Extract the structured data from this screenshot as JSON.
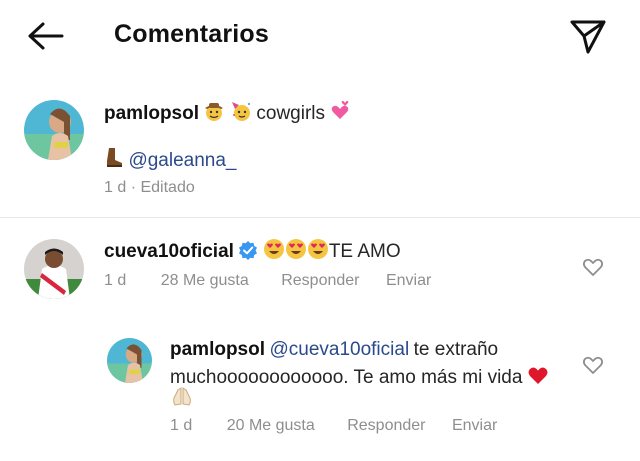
{
  "header": {
    "title": "Comentarios",
    "back_icon": "arrow-left-icon",
    "share_icon": "paper-plane-icon"
  },
  "caption": {
    "username": "pamlopsol",
    "text": "cowgirls",
    "line2_mention": "@galeanna_",
    "time": "1 d",
    "separator": "·",
    "edited": "Editado",
    "emojis": [
      "cowboy-face",
      "partying-face",
      "two-hearts",
      "boot"
    ]
  },
  "comments": [
    {
      "username": "cueva10oficial",
      "verified": true,
      "text": "TE AMO",
      "emojis": [
        "heart-eyes",
        "heart-eyes",
        "heart-eyes"
      ],
      "time": "1 d",
      "likes": "28 Me gusta",
      "reply": "Responder",
      "send": "Enviar"
    },
    {
      "username": "pamlopsol",
      "mention": "@cueva10oficial",
      "text_line1_rest": "te extraño",
      "text_line2": "muchoooooooooooo. Te amo más mi vida",
      "emojis": [
        "red-heart",
        "praying-hands"
      ],
      "time": "1 d",
      "likes": "20 Me gusta",
      "reply": "Responder",
      "send": "Enviar"
    }
  ],
  "colors": {
    "text": "#111111",
    "meta": "#8e8e8e",
    "mention": "#2b4a8a",
    "verified": "#3897f0",
    "divider": "#e6e6e6"
  }
}
